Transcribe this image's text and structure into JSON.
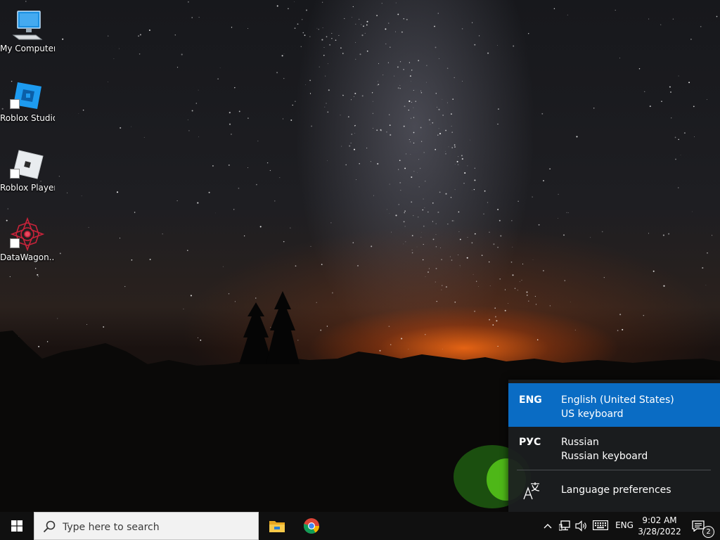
{
  "desktop": {
    "icons": [
      {
        "label": "My Computer",
        "icon": "computer-icon"
      },
      {
        "label": "Roblox Studio",
        "icon": "roblox-studio-icon"
      },
      {
        "label": "Roblox Player",
        "icon": "roblox-player-icon"
      },
      {
        "label": "DataWagon...",
        "icon": "datawagon-icon"
      }
    ]
  },
  "language_flyout": {
    "items": [
      {
        "code": "ENG",
        "name": "English (United States)",
        "keyboard": "US keyboard",
        "selected": true
      },
      {
        "code": "РУС",
        "name": "Russian",
        "keyboard": "Russian keyboard",
        "selected": false
      }
    ],
    "preferences_label": "Language preferences",
    "accent_color": "#0a6cc4"
  },
  "taskbar": {
    "search_placeholder": "Type here to search",
    "pinned_apps": [
      "file-explorer-icon",
      "chrome-icon"
    ],
    "tray": {
      "language": "ENG",
      "time": "9:02 AM",
      "date": "3/28/2022",
      "notification_count": "2"
    }
  }
}
